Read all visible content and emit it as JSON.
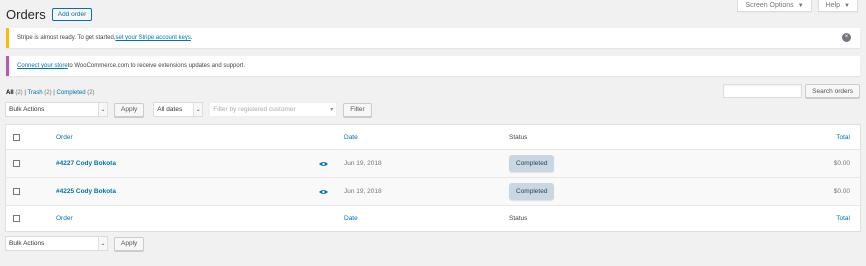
{
  "screen_tabs": [
    {
      "label": "Screen Options"
    },
    {
      "label": "Help"
    }
  ],
  "header": {
    "title": "Orders",
    "add_label": "Add order"
  },
  "notices": {
    "stripe": {
      "pre": "Stripe is almost ready. To get started, ",
      "link": "set your Stripe account keys",
      "post": "."
    },
    "woo": {
      "link": "Connect your store",
      "post": " to WooCommerce.com to receive extensions updates and support."
    }
  },
  "filters": {
    "all": "All",
    "all_count": "(2)",
    "trash": "Trash",
    "trash_count": "(2)",
    "completed": "Completed",
    "completed_count": "(2)"
  },
  "search": {
    "button": "Search orders"
  },
  "tablenav": {
    "bulk_actions": "Bulk Actions",
    "apply": "Apply",
    "dates": "All dates",
    "customer_placeholder": "Filter by registered customer",
    "filter": "Filter"
  },
  "table": {
    "columns": {
      "order": "Order",
      "date": "Date",
      "status": "Status",
      "total": "Total"
    },
    "rows": [
      {
        "order": "#4227 Cody Bokota",
        "date": "Jun 19, 2018",
        "status": "Completed",
        "total": "$0.00"
      },
      {
        "order": "#4225 Cody Bokota",
        "date": "Jun 19, 2018",
        "status": "Completed",
        "total": "$0.00"
      }
    ]
  },
  "icons": {
    "preview": "eye-icon",
    "dismiss": "close-circle-icon",
    "dropdown": "chevron-down-icon"
  }
}
